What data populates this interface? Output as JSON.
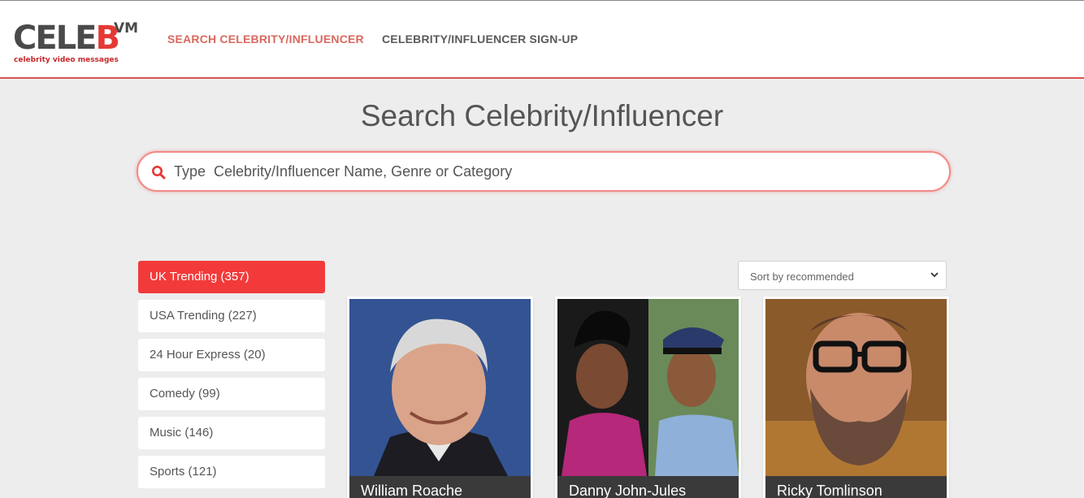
{
  "header": {
    "logo": {
      "main_prefix": "CELE",
      "main_highlight": "B",
      "sup": "VM",
      "tagline": "celebrity video messages"
    },
    "nav": [
      {
        "label": "SEARCH CELEBRITY/INFLUENCER"
      },
      {
        "label": "CELEBRITY/INFLUENCER SIGN-UP"
      }
    ]
  },
  "search": {
    "title": "Search Celebrity/Influencer",
    "placeholder": "Type  Celebrity/Influencer Name, Genre or Category",
    "icon": "search-icon"
  },
  "categories": [
    {
      "label": "UK Trending (357)",
      "active": true
    },
    {
      "label": "USA Trending (227)",
      "active": false
    },
    {
      "label": "24 Hour Express (20)",
      "active": false
    },
    {
      "label": "Comedy (99)",
      "active": false
    },
    {
      "label": "Music (146)",
      "active": false
    },
    {
      "label": "Sports (121)",
      "active": false
    }
  ],
  "sort": {
    "selected": "Sort by recommended"
  },
  "celebrities": [
    {
      "name": "William Roache"
    },
    {
      "name": "Danny John-Jules"
    },
    {
      "name": "Ricky Tomlinson"
    }
  ],
  "colors": {
    "accent": "#f23a3a",
    "nav_active": "#d9695f",
    "header_border": "#d9534f",
    "card_label_bg": "#3a3a3a",
    "page_bg": "#ededed"
  }
}
